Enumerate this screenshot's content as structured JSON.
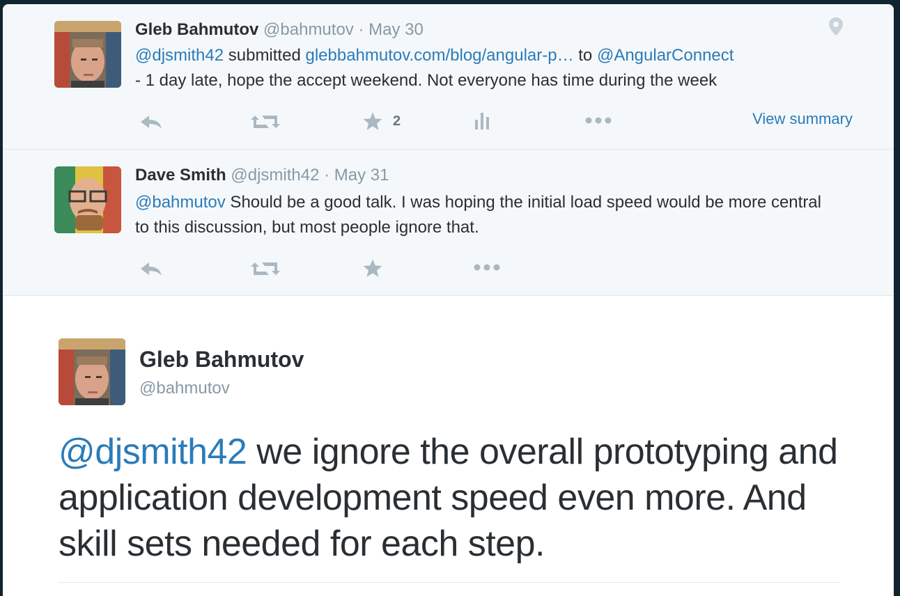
{
  "tweet1": {
    "name": "Gleb Bahmutov",
    "handle": "@bahmutov",
    "date": "May 30",
    "mention": "@djsmith42",
    "text_a": " submitted ",
    "url": "glebbahmutov.com/blog/angular-p…",
    "text_b": " to ",
    "mention2": "@AngularConnect",
    "text_c": "- 1 day late, hope the accept weekend. Not everyone has time during the week",
    "favorites": "2",
    "view_summary": "View summary"
  },
  "tweet2": {
    "name": "Dave Smith",
    "handle": "@djsmith42",
    "date": "May 31",
    "mention": "@bahmutov",
    "text": " Should be a good talk. I was hoping the initial load speed would be more central to this discussion, but most people ignore that."
  },
  "main": {
    "name": "Gleb Bahmutov",
    "handle": "@bahmutov",
    "mention": "@djsmith42",
    "text": " we ignore the overall prototyping and application development speed even more. And skill sets needed for each step."
  },
  "separator": " · ",
  "icons": {
    "reply": "reply-icon",
    "retweet": "retweet-icon",
    "favorite": "star-icon",
    "analytics": "analytics-icon",
    "more": "more-icon",
    "geo": "location-pin-icon"
  },
  "colors": {
    "link": "#2b7bb9",
    "muted": "#8899a6",
    "icon": "#aab8c2",
    "conversation_bg": "#f5f8fa"
  }
}
